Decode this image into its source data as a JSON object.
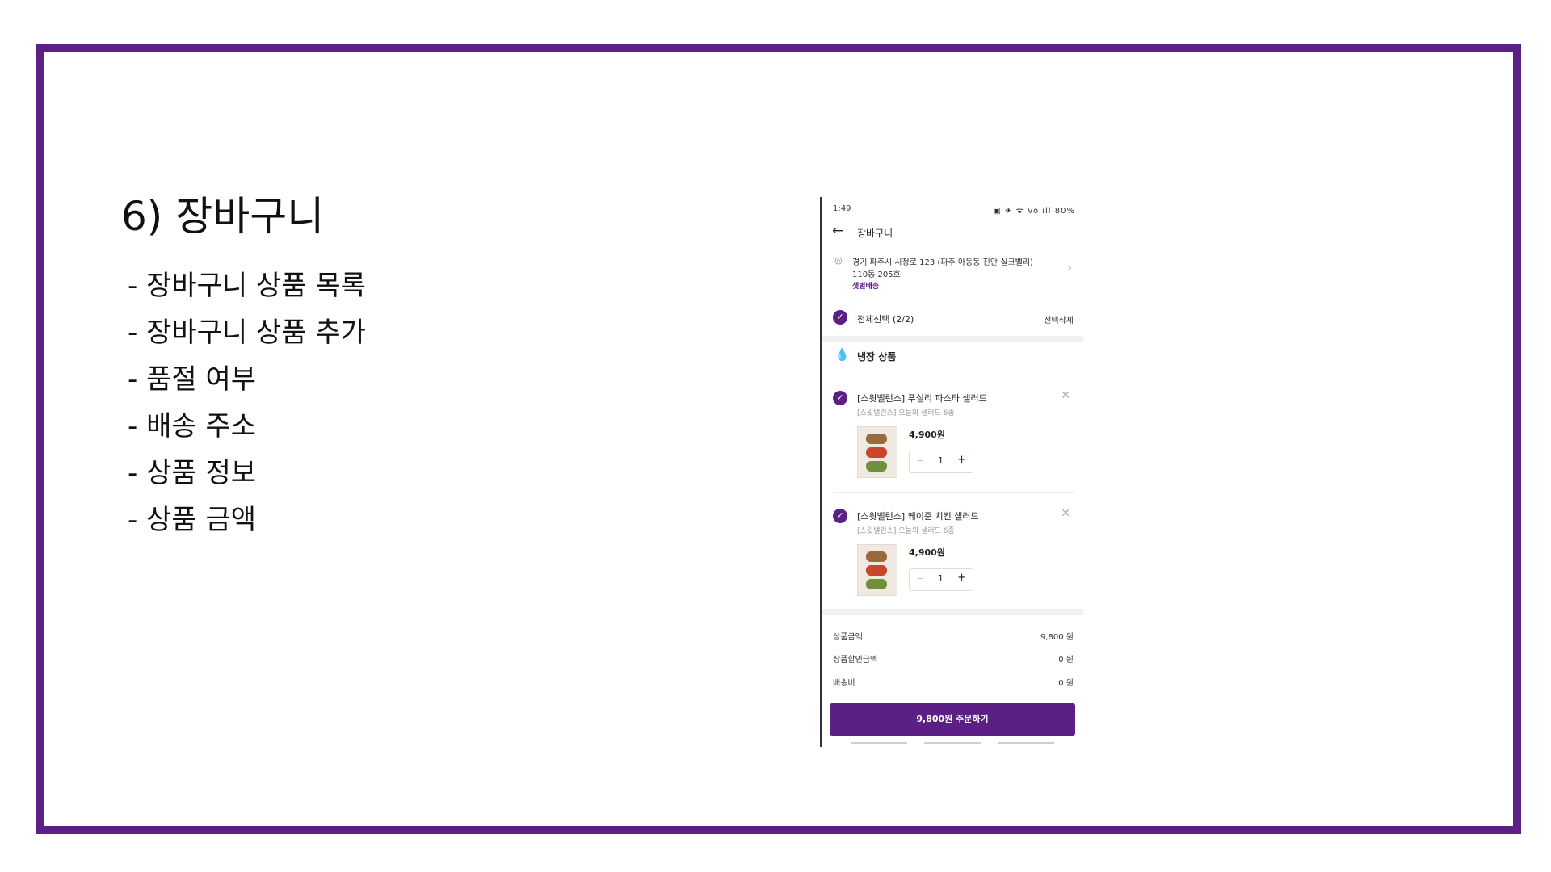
{
  "slide": {
    "title": "6)  장바구니",
    "bullets": [
      "- 장바구니 상품 목록",
      "- 장바구니 상품 추가",
      "- 품절 여부",
      "- 배송 주소",
      "- 상품 정보",
      "- 상품 금액"
    ]
  },
  "phone": {
    "status_time": "1:49",
    "status_icons": "▣ ✈ ᯤ Vo ıll 80%",
    "battery": "80%",
    "title": "장바구니",
    "address_line1": "경기 파주시 시청로 123 (파주 아동동 진안 실크밸리)",
    "address_line2": "110동 205호",
    "delivery_tag": "샛별배송",
    "select_all_label": "전체선택 (2/2)",
    "delete_selected_label": "선택삭제",
    "section_label": "냉장 상품",
    "items": [
      {
        "name": "[스윗밸런스] 푸실리 파스타 샐러드",
        "sub": "[스윗밸런스] 오늘의 샐러드 6종",
        "price": "4,900원",
        "qty": "1"
      },
      {
        "name": "[스윗밸런스] 케이준 치킨 샐러드",
        "sub": "[스윗밸런스] 오늘의 샐러드 6종",
        "price": "4,900원",
        "qty": "1"
      }
    ],
    "summary": [
      {
        "label": "상품금액",
        "value": "9,800 원"
      },
      {
        "label": "상품할인금액",
        "value": "0 원"
      },
      {
        "label": "배송비",
        "value": "0 원"
      }
    ],
    "order_button": "9,800원 주문하기"
  },
  "colors": {
    "accent": "#5b1f86",
    "frame": "#5b1f86",
    "cold_icon": "#4aa89b"
  }
}
